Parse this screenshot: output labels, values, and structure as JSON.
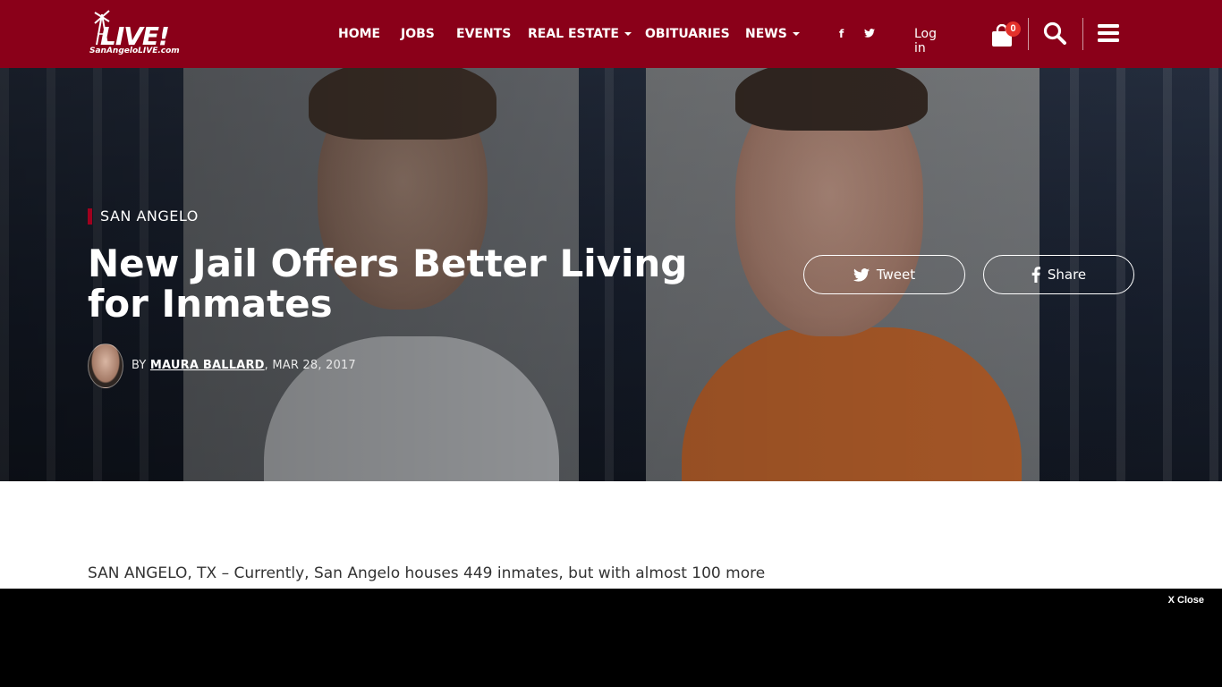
{
  "site": {
    "logo_text": "LIVE!",
    "logo_subtext": "SanAngeloLIVE.com"
  },
  "nav": {
    "items": [
      {
        "label": "HOME",
        "has_dropdown": false
      },
      {
        "label": "JOBS",
        "has_dropdown": false
      },
      {
        "label": "EVENTS",
        "has_dropdown": false
      },
      {
        "label": "REAL ESTATE",
        "has_dropdown": true
      },
      {
        "label": "OBITUARIES",
        "has_dropdown": false
      },
      {
        "label": "NEWS",
        "has_dropdown": true
      }
    ],
    "social": [
      {
        "icon": "facebook-icon",
        "glyph": "f"
      },
      {
        "icon": "twitter-icon",
        "glyph": "t"
      }
    ],
    "login_label": "Log in",
    "cart_count": "0"
  },
  "article": {
    "category": "SAN ANGELO",
    "title": "New Jail Offers Better Living for Inmates",
    "byline_prefix": "BY ",
    "author": "MAURA BALLARD",
    "date": ", MAR 28, 2017",
    "share_buttons": [
      {
        "label": "Tweet",
        "icon": "twitter-icon"
      },
      {
        "label": "Share",
        "icon": "facebook-icon"
      }
    ],
    "body_first_line": "SAN ANGELO, TX – Currently, San Angelo houses 449 inmates, but with almost 100 more"
  },
  "ad": {
    "close_label": "X Close"
  },
  "colors": {
    "header_bg": "#8a0019",
    "accent": "#a0001e",
    "badge": "#e4312b"
  }
}
